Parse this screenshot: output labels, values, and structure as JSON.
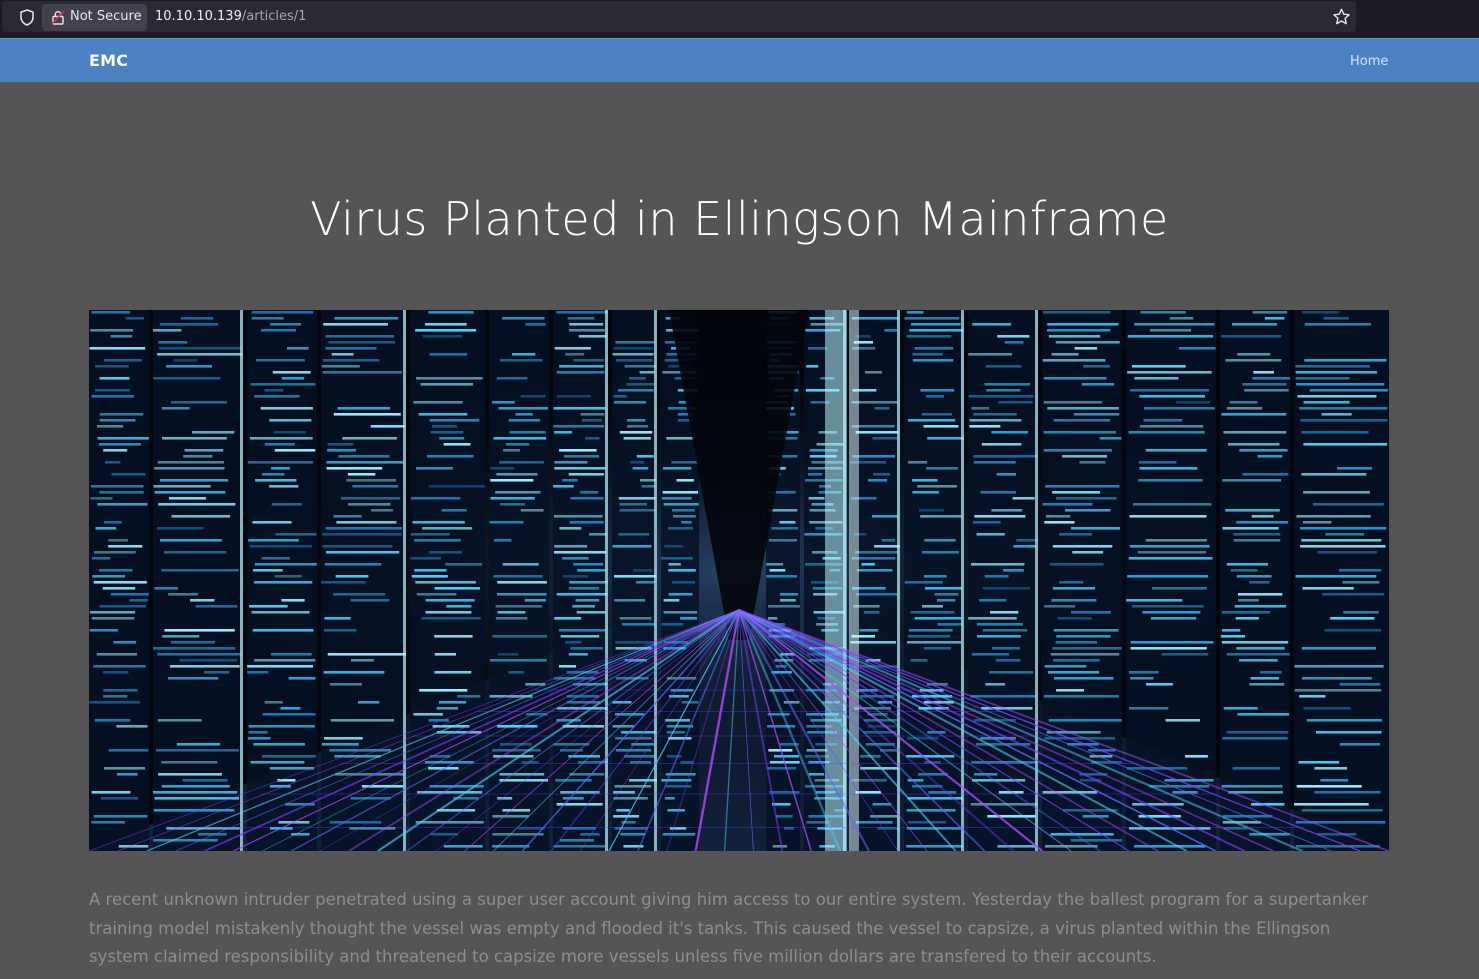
{
  "browser": {
    "security_label": "Not Secure",
    "url_host": "10.10.10.139",
    "url_path": "/articles/1",
    "icons": [
      "shield-icon",
      "lock-icon",
      "star-icon"
    ]
  },
  "navbar": {
    "brand": "EMC",
    "links": [
      {
        "label": "Home"
      }
    ],
    "color": "#4b81c3"
  },
  "article": {
    "title": "Virus Planted in Ellingson Mainframe",
    "body": "A recent unknown intruder penetrated using a super user account giving him access to our entire system. Yesterday the ballest program for a supertanker training model mistakenly thought the vessel was empty and flooded it's tanks. This caused the vessel to capsize, a virus planted within the Ellingson system claimed responsibility and threatened to capsize more vessels unless five million dollars are transfered to their accounts."
  },
  "colors": {
    "page_background": "#555555",
    "body_text": "#8e8e8e",
    "title_text": "#ffffff"
  }
}
